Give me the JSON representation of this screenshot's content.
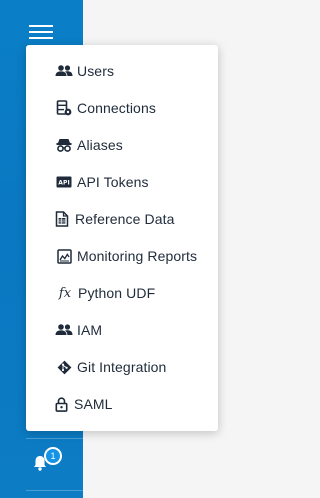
{
  "menu": {
    "items": [
      {
        "label": "Users",
        "icon": "users-icon"
      },
      {
        "label": "Connections",
        "icon": "connections-icon"
      },
      {
        "label": "Aliases",
        "icon": "aliases-icon"
      },
      {
        "label": "API Tokens",
        "icon": "api-icon"
      },
      {
        "label": "Reference Data",
        "icon": "reference-data-icon"
      },
      {
        "label": "Monitoring Reports",
        "icon": "monitoring-reports-icon"
      },
      {
        "label": "Python UDF",
        "icon": "fx-icon"
      },
      {
        "label": "IAM",
        "icon": "iam-icon"
      },
      {
        "label": "Git Integration",
        "icon": "git-icon"
      },
      {
        "label": "SAML",
        "icon": "lock-icon"
      }
    ]
  },
  "notifications": {
    "count": "1"
  },
  "colors": {
    "sidebar": "#0a7fc7",
    "text": "#1f2b3a",
    "badge": "#1594e6"
  }
}
